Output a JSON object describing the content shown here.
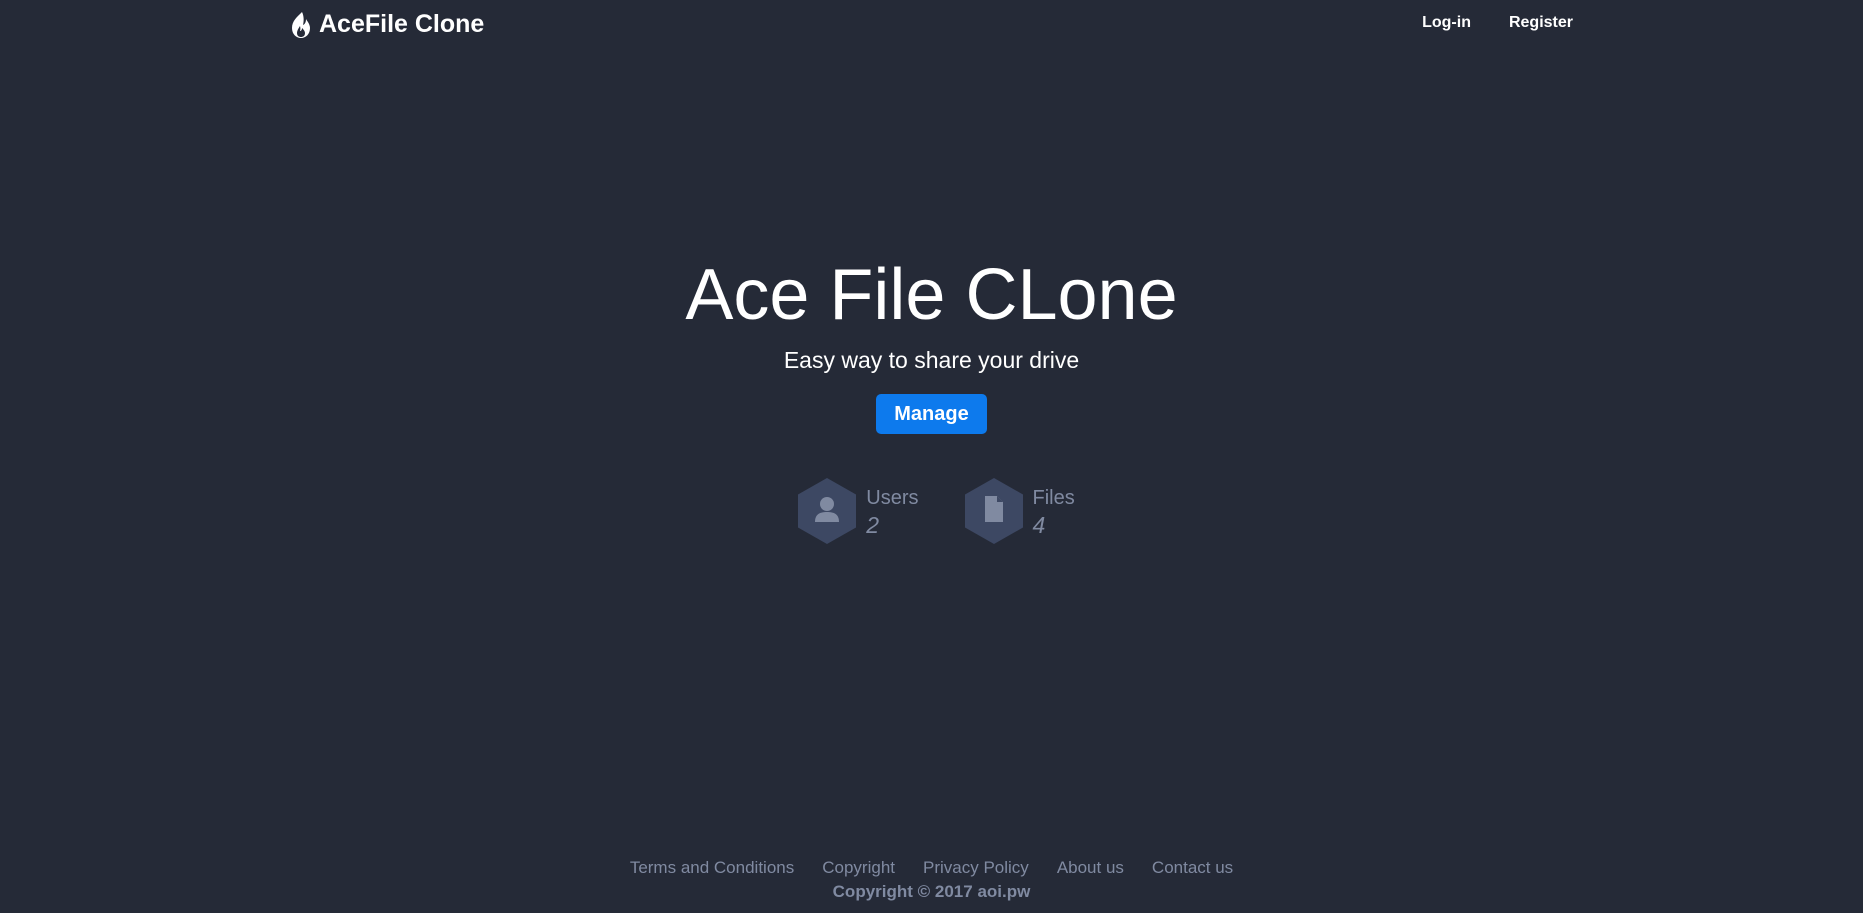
{
  "header": {
    "brand": "AceFile Clone",
    "brand_icon": "fire-icon",
    "nav": {
      "login": "Log-in",
      "register": "Register"
    }
  },
  "hero": {
    "title": "Ace File CLone",
    "subtitle": "Easy way to share your drive",
    "manage_label": "Manage"
  },
  "stats": {
    "users": {
      "label": "Users",
      "value": "2",
      "icon": "user-icon"
    },
    "files": {
      "label": "Files",
      "value": "4",
      "icon": "file-icon"
    }
  },
  "footer": {
    "links": {
      "terms": "Terms and Conditions",
      "copyright": "Copyright",
      "privacy": "Privacy Policy",
      "about": "About us",
      "contact": "Contact us"
    },
    "copyright_text": "Copyright © 2017 aoi.pw"
  },
  "colors": {
    "background": "#252a37",
    "accent": "#0d7aed",
    "muted": "#808aa1",
    "hexagon": "#3d4863"
  }
}
